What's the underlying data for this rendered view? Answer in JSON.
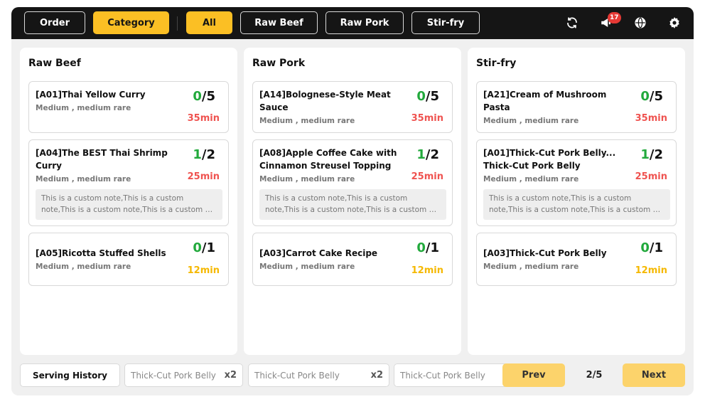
{
  "topbar": {
    "buttons": [
      {
        "label": "Order",
        "active": false
      },
      {
        "label": "Category",
        "active": true
      },
      {
        "label": "All",
        "active": true
      },
      {
        "label": "Raw Beef",
        "active": false
      },
      {
        "label": "Raw Pork",
        "active": false
      },
      {
        "label": "Stir-fry",
        "active": false
      }
    ],
    "notification_count": "17",
    "icons": [
      "refresh-icon",
      "megaphone-icon",
      "globe-icon",
      "gear-icon"
    ]
  },
  "columns": [
    {
      "title": "Raw Beef",
      "cards": [
        {
          "name": "[A01]Thai Yellow Curry",
          "sub": "Medium , medium rare",
          "done": "0",
          "total": "5",
          "time": "35min",
          "time_color": "red"
        },
        {
          "name": "[A04]The BEST Thai Shrimp Curry",
          "sub": "Medium , medium rare",
          "done": "1",
          "total": "2",
          "time": "25min",
          "time_color": "red",
          "note_line1": "This is a custom note,This is a custom",
          "note_line2": "note,This is a custom note,This is a custom n..."
        },
        {
          "name": "[A05]Ricotta Stuffed Shells",
          "sub": "Medium , medium rare",
          "done": "0",
          "total": "1",
          "time": "12min",
          "time_color": "yellow"
        }
      ]
    },
    {
      "title": "Raw Pork",
      "cards": [
        {
          "name": "[A14]Bolognese-Style Meat Sauce",
          "sub": "Medium , medium rare",
          "done": "0",
          "total": "5",
          "time": "35min",
          "time_color": "red"
        },
        {
          "name": "[A08]Apple Coffee Cake with Cinnamon Streusel Topping",
          "sub": "Medium , medium rare",
          "done": "1",
          "total": "2",
          "time": "25min",
          "time_color": "red",
          "note_line1": "This is a custom note,This is a custom",
          "note_line2": "note,This is a custom note,This is a custom n..."
        },
        {
          "name": "[A03]Carrot Cake Recipe",
          "sub": "Medium , medium rare",
          "done": "0",
          "total": "1",
          "time": "12min",
          "time_color": "yellow"
        }
      ]
    },
    {
      "title": "Stir-fry",
      "cards": [
        {
          "name": "[A21]Cream of Mushroom Pasta",
          "sub": "Medium , medium rare",
          "done": "0",
          "total": "5",
          "time": "35min",
          "time_color": "red"
        },
        {
          "name": "[A01]Thick-Cut Pork Belly... Thick-Cut Pork Belly",
          "sub": "Medium , medium rare",
          "done": "1",
          "total": "2",
          "time": "25min",
          "time_color": "red",
          "note_line1": "This is a custom note,This is a custom",
          "note_line2": "note,This is a custom note,This is a custom n..."
        },
        {
          "name": "[A03]Thick-Cut Pork Belly",
          "sub": "Medium , medium rare",
          "done": "0",
          "total": "1",
          "time": "12min",
          "time_color": "yellow"
        }
      ]
    }
  ],
  "footer": {
    "history_label": "Serving History",
    "items": [
      {
        "name": "Thick-Cut Pork Belly",
        "qty": "x2"
      },
      {
        "name": "Thick-Cut Pork Belly",
        "qty": "x2"
      },
      {
        "name": "Thick-Cut Pork Belly",
        "qty": ""
      }
    ],
    "prev_label": "Prev",
    "page": "2/5",
    "next_label": "Next"
  },
  "colors": {
    "accent": "#fbbf24",
    "topbar": "#151515",
    "done_green": "#22a93c",
    "time_red": "#ef5350",
    "time_yellow": "#f5b800",
    "nav_button": "#fcd36b"
  }
}
